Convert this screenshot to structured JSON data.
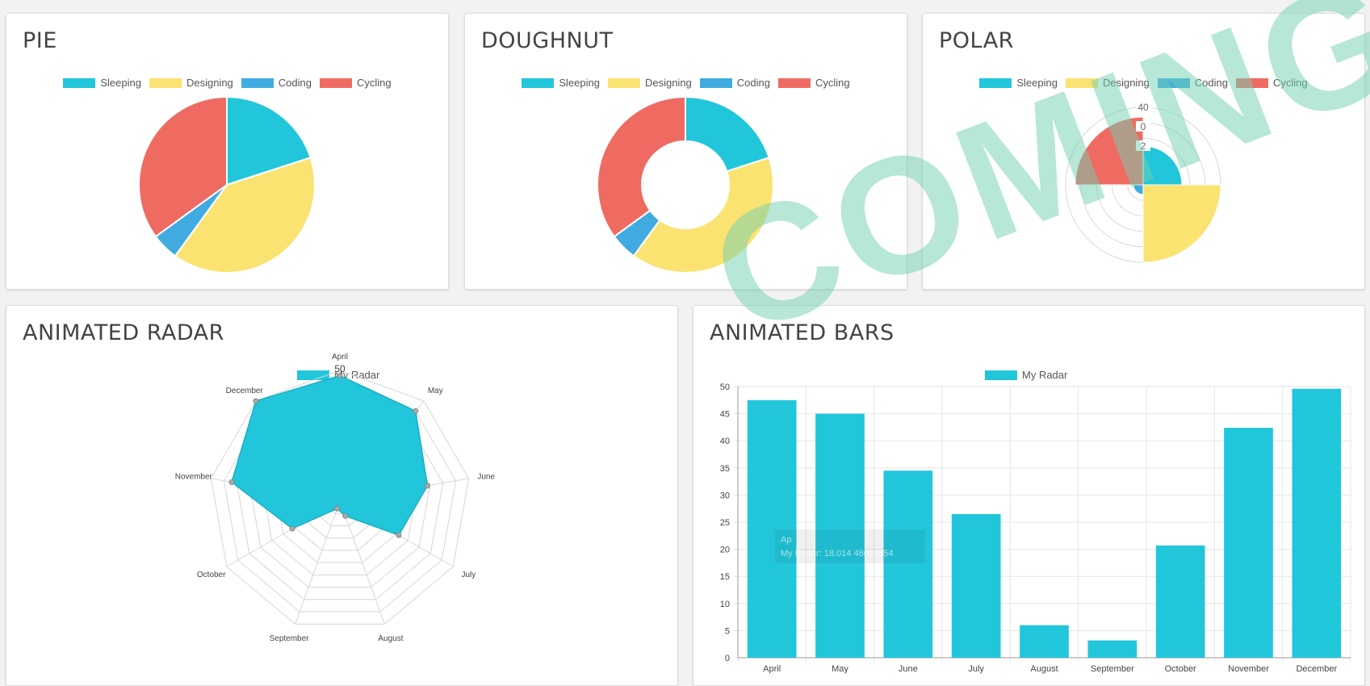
{
  "colors": {
    "sleeping": "#22c6db",
    "designing": "#fbe372",
    "coding": "#41abe1",
    "cycling": "#ef6b62",
    "radar": "#22c6db",
    "watermark": "#6fcfb0"
  },
  "watermark": {
    "text": "COMING SOON"
  },
  "pie": {
    "title": "PIE",
    "legend": [
      "Sleeping",
      "Designing",
      "Coding",
      "Cycling"
    ],
    "chart_data": {
      "type": "pie",
      "categories": [
        "Sleeping",
        "Designing",
        "Coding",
        "Cycling"
      ],
      "values": [
        20,
        40,
        5,
        35
      ]
    }
  },
  "doughnut": {
    "title": "DOUGHNUT",
    "legend": [
      "Sleeping",
      "Designing",
      "Coding",
      "Cycling"
    ],
    "chart_data": {
      "type": "pie",
      "categories": [
        "Sleeping",
        "Designing",
        "Coding",
        "Cycling"
      ],
      "values": [
        20,
        40,
        5,
        35
      ]
    }
  },
  "polar": {
    "title": "POLAR",
    "legend": [
      "Sleeping",
      "Designing",
      "Coding",
      "Cycling"
    ],
    "ticks": [
      "40",
      "0",
      "2"
    ],
    "chart_data": {
      "type": "polar",
      "categories": [
        "Sleeping",
        "Designing",
        "Coding",
        "Cycling"
      ],
      "values": [
        20,
        40,
        5,
        35
      ],
      "rmax": 40
    }
  },
  "radar": {
    "title": "ANIMATED RADAR",
    "legend": [
      "My Radar"
    ],
    "tick_label": "50",
    "chart_data": {
      "type": "radar",
      "categories": [
        "April",
        "May",
        "June",
        "July",
        "August",
        "September",
        "October",
        "November",
        "December"
      ],
      "series": [
        {
          "name": "My Radar",
          "values": [
            48,
            45,
            34,
            26,
            6,
            3,
            21,
            42,
            50
          ]
        }
      ],
      "rmax": 50
    }
  },
  "bars": {
    "title": "ANIMATED BARS",
    "legend": [
      "My Radar"
    ],
    "tooltip": {
      "line1": "Ap",
      "line2": "My Radar: 18.014  48026654"
    },
    "chart_data": {
      "type": "bar",
      "categories": [
        "April",
        "May",
        "June",
        "July",
        "August",
        "September",
        "October",
        "November",
        "December"
      ],
      "series": [
        {
          "name": "My Radar",
          "values": [
            47.5,
            45,
            34.5,
            26.5,
            6,
            3.2,
            20.7,
            42.4,
            49.6
          ]
        }
      ],
      "ylim": [
        0,
        50
      ],
      "yticks": [
        0,
        5,
        10,
        15,
        20,
        25,
        30,
        35,
        40,
        45,
        50
      ]
    }
  }
}
